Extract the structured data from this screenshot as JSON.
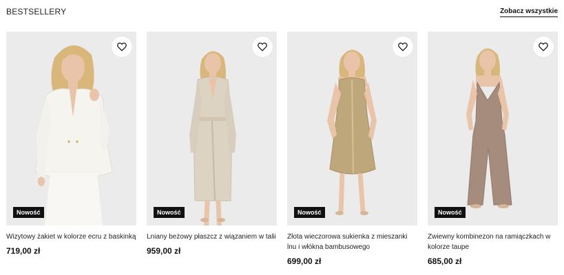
{
  "section": {
    "title": "BESTSELLERY",
    "see_all": "Zobacz wszystkie"
  },
  "products": [
    {
      "name": "Wizytowy żakiet w kolorze ecru z baskinką",
      "price": "719,00 zł",
      "badge": "Nowość",
      "garment_color": "#f6f4ef",
      "wishlist_icon": "heart-outline-icon"
    },
    {
      "name": "Lniany beżowy płaszcz z wiązaniem w talii",
      "price": "959,00 zł",
      "badge": "Nowość",
      "garment_color": "#ddd3c3",
      "wishlist_icon": "heart-outline-icon"
    },
    {
      "name": "Złota wieczorowa sukienka z mieszanki lnu i włókna bambusowego",
      "price": "699,00 zł",
      "badge": "Nowość",
      "garment_color": "#bfa77c",
      "wishlist_icon": "heart-outline-icon"
    },
    {
      "name": "Zwiewny kombinezon na ramiączkach w kolorze taupe",
      "price": "685,00 zł",
      "badge": "Nowość",
      "garment_color": "#a68c7c",
      "wishlist_icon": "heart-outline-icon"
    }
  ],
  "colors": {
    "photo_bg": "#ebebeb",
    "badge_bg": "#111111",
    "text": "#111111",
    "hair": "#d9b77a",
    "skin": "#e9c4a8"
  }
}
